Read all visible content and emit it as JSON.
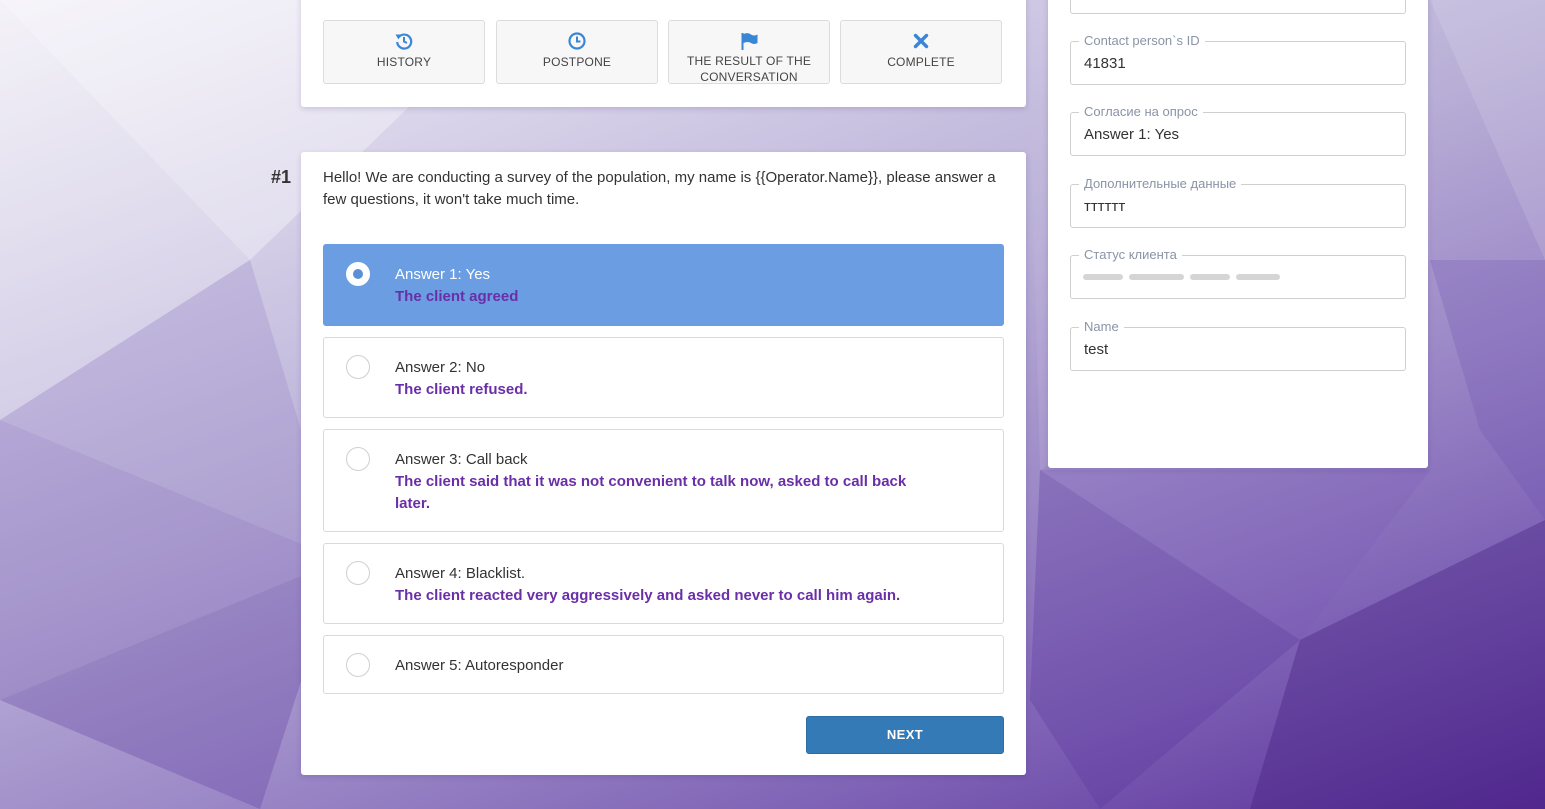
{
  "toolbar": {
    "buttons": [
      {
        "label": "HISTORY",
        "icon": "history-icon"
      },
      {
        "label": "POSTPONE",
        "icon": "clock-icon"
      },
      {
        "label": "THE RESULT OF THE CONVERSATION",
        "icon": "flag-icon"
      },
      {
        "label": "COMPLETE",
        "icon": "close-icon"
      }
    ]
  },
  "question": {
    "number": "#1",
    "text": "Hello! We are conducting a survey of the population, my name is {{Operator.Name}}, please answer a few questions, it won't take much time.",
    "answers": [
      {
        "title": "Answer 1: Yes",
        "description": "The client agreed",
        "selected": true
      },
      {
        "title": "Answer 2: No",
        "description": "The client refused.",
        "selected": false
      },
      {
        "title": "Answer 3: Call back",
        "description": "The client said that it was not convenient to talk now, asked to call back later.",
        "selected": false
      },
      {
        "title": "Answer 4: Blacklist.",
        "description": "The client reacted very aggressively and asked never to call him again.",
        "selected": false
      },
      {
        "title": "Answer 5: Autoresponder",
        "description": "",
        "selected": false
      }
    ],
    "next_label": "NEXT"
  },
  "side_panel": {
    "fields": [
      {
        "label": "Contact person`s ID",
        "value": "41831"
      },
      {
        "label": "Согласие на опрос",
        "value": "Answer 1: Yes"
      },
      {
        "label": "Дополнительные данные",
        "value": "тттттт"
      },
      {
        "label": "Статус клиента",
        "value": ""
      },
      {
        "label": "Name",
        "value": "test"
      }
    ]
  },
  "colors": {
    "selected_answer": "#6a9de1",
    "answer_description": "#6a2fa8",
    "next_button": "#337ab7",
    "toolbar_icon": "#3a86d6"
  }
}
